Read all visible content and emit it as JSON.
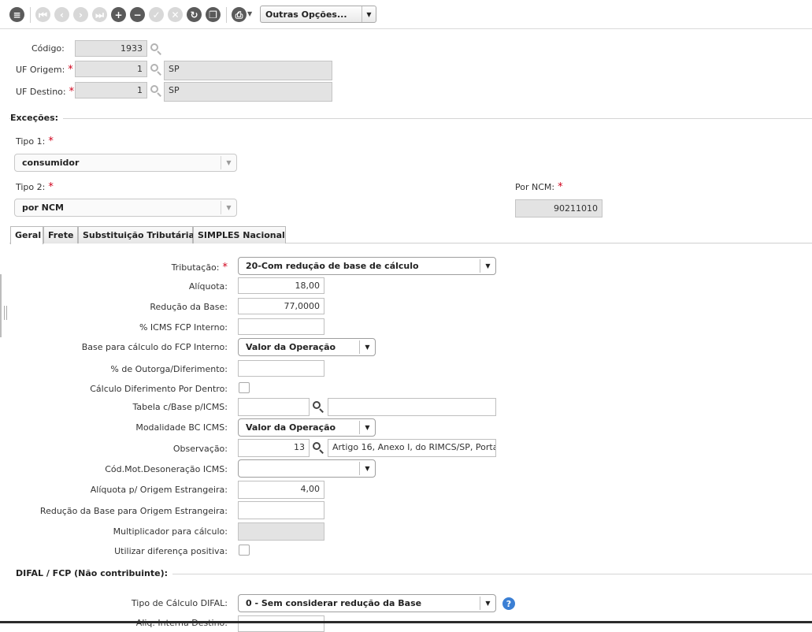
{
  "toolbar": {
    "options_label": "Outras Opções...",
    "icons": [
      "list-icon",
      "first-icon",
      "previous-icon",
      "next-icon",
      "last-icon",
      "add-icon",
      "remove-icon",
      "confirm-icon",
      "cancel-icon",
      "refresh-icon",
      "copy-icon",
      "print-icon"
    ]
  },
  "header": {
    "codigo": {
      "label": "Código:",
      "value": "1933"
    },
    "uf_origem": {
      "label": "UF Origem:",
      "value": "1",
      "desc": "SP"
    },
    "uf_destino": {
      "label": "UF Destino:",
      "value": "1",
      "desc": "SP"
    }
  },
  "excecoes": {
    "title": "Exceções:",
    "tipo1": {
      "label": "Tipo 1:",
      "value": "consumidor"
    },
    "tipo2": {
      "label": "Tipo 2:",
      "value": "por NCM"
    },
    "por_ncm": {
      "label": "Por NCM:",
      "value": "90211010"
    }
  },
  "tabs": [
    {
      "label": "Geral",
      "active": true
    },
    {
      "label": "Frete"
    },
    {
      "label": "Substituição Tributária"
    },
    {
      "label": "SIMPLES Nacional"
    }
  ],
  "geral": {
    "tributacao": {
      "label": "Tributação:",
      "value": "20-Com redução de base de cálculo"
    },
    "aliquota": {
      "label": "Alíquota:",
      "value": "18,00"
    },
    "reducao_base": {
      "label": "Redução da Base:",
      "value": "77,0000"
    },
    "icms_fcp_interno": {
      "label": "% ICMS FCP Interno:",
      "value": ""
    },
    "base_fcp_interno": {
      "label": "Base para cálculo do FCP Interno:",
      "value": "Valor da Operação"
    },
    "outorga": {
      "label": "% de Outorga/Diferimento:",
      "value": ""
    },
    "calc_diferimento": {
      "label": "Cálculo Diferimento Por Dentro:"
    },
    "tabela_base": {
      "label": "Tabela c/Base p/ICMS:",
      "value": "",
      "desc": ""
    },
    "modalidade_bc": {
      "label": "Modalidade BC ICMS:",
      "value": "Valor da Operação"
    },
    "observacao": {
      "label": "Observação:",
      "value": "13",
      "desc": "Artigo 16, Anexo I, do RIMCS/SP, Porta"
    },
    "cod_mot_desoneracao": {
      "label": "Cód.Mot.Desoneração ICMS:",
      "value": ""
    },
    "aliquota_origem_estrangeira": {
      "label": "Alíquota p/ Origem Estrangeira:",
      "value": "4,00"
    },
    "reducao_origem_estrangeira": {
      "label": "Redução da Base para Origem Estrangeira:",
      "value": ""
    },
    "multiplicador": {
      "label": "Multiplicador para cálculo:",
      "value": ""
    },
    "diferenca_positiva": {
      "label": "Utilizar diferença positiva:"
    }
  },
  "difal": {
    "title": "DIFAL / FCP (Não contribuinte):",
    "tipo_calculo": {
      "label": "Tipo de Cálculo DIFAL:",
      "value": "0 - Sem considerar redução da Base"
    },
    "aliq_interna_destino": {
      "label": "Aliq. Interna Destino:"
    },
    "help": "?"
  }
}
